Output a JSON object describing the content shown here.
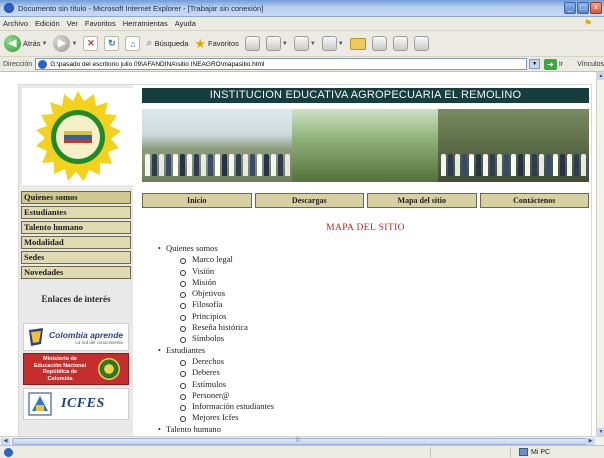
{
  "window": {
    "title": "Documento sin título - Microsoft Internet Explorer - [Trabajar sin conexión]",
    "controls": [
      "_",
      "□",
      "×"
    ]
  },
  "menu": [
    "Archivo",
    "Edición",
    "Ver",
    "Favoritos",
    "Herramientas",
    "Ayuda"
  ],
  "toolbar": {
    "back_label": "Atrás",
    "search_label": "Búsqueda",
    "favorites_label": "Favoritos"
  },
  "address": {
    "label": "Dirección",
    "url": "G:\\pasado del escritorio julio 09\\AFANDINA\\sitio INEAGRO\\mapasitio.html",
    "go_label": "Ir",
    "links_label": "Vínculos"
  },
  "status": {
    "zone_label": "Mi PC"
  },
  "site": {
    "header_title": "INSTITUCION EDUCATIVA AGROPECUARIA EL REMOLINO",
    "sidebar_nav": [
      "Quienes somos",
      "Estudiantes",
      "Talento humano",
      "Modalidad",
      "Sedes",
      "Novedades"
    ],
    "links_heading": "Enlaces de interés",
    "banners": {
      "colombia_aprende_title": "Colombia aprende",
      "colombia_aprende_sub": "La red del conocimiento",
      "ministerio_text": "Ministerio de Educación Nacional República de Colombia",
      "icfes_text": "ICFES"
    },
    "top_nav": [
      "Inicio",
      "Descargas",
      "Mapa del sitio",
      "Contáctenos"
    ],
    "map_title": "MAPA DEL SITIO",
    "sitemap": [
      {
        "label": "Quienes somos",
        "children": [
          "Marco legal",
          "Visión",
          "Misión",
          "Objetivos",
          "Filosofía",
          "Principios",
          "Reseña histórica",
          "Símbolos"
        ]
      },
      {
        "label": "Estudiantes",
        "children": [
          "Derechos",
          "Deberes",
          "Estímulos",
          "Personer@",
          "Información estudiantes",
          "Mejores Icfes"
        ]
      },
      {
        "label": "Talento humano",
        "children": []
      }
    ]
  },
  "colors": {
    "header_bg": "#163e3e",
    "nav_bg": "#e0dab2",
    "map_title": "#c41f1f",
    "ie_title": "#6f9bd6"
  }
}
